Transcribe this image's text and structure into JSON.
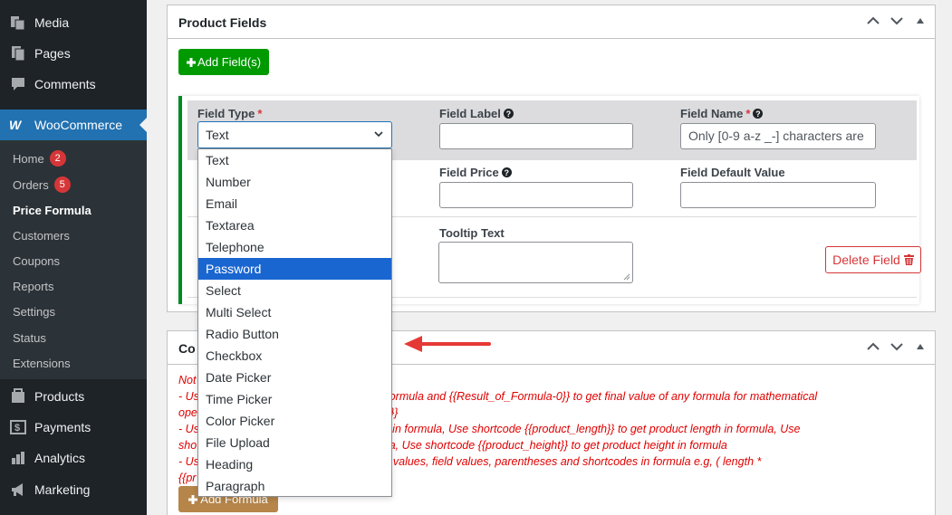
{
  "sidebar": {
    "top_items": [
      {
        "label": "Media",
        "icon": "media-icon"
      },
      {
        "label": "Pages",
        "icon": "pages-icon"
      },
      {
        "label": "Comments",
        "icon": "comments-icon"
      }
    ],
    "woocommerce": {
      "label": "WooCommerce",
      "icon": "woocommerce-icon"
    },
    "submenu": [
      {
        "label": "Home",
        "badge": "2"
      },
      {
        "label": "Orders",
        "badge": "5"
      },
      {
        "label": "Price Formula",
        "current": true
      },
      {
        "label": "Customers"
      },
      {
        "label": "Coupons"
      },
      {
        "label": "Reports"
      },
      {
        "label": "Settings"
      },
      {
        "label": "Status"
      },
      {
        "label": "Extensions"
      }
    ],
    "bottom_items": [
      {
        "label": "Products",
        "icon": "products-icon"
      },
      {
        "label": "Payments",
        "icon": "payments-icon"
      },
      {
        "label": "Analytics",
        "icon": "analytics-icon"
      },
      {
        "label": "Marketing",
        "icon": "marketing-icon"
      }
    ]
  },
  "product_fields": {
    "title": "Product Fields",
    "add_button": "Add Field(s)",
    "field_type_label": "Field Type",
    "field_type_value": "Text",
    "field_label_label": "Field Label",
    "field_name_label": "Field Name",
    "field_name_placeholder": "Only [0-9 a-z _-] characters are",
    "field_price_label": "Field Price",
    "field_default_label": "Field Default Value",
    "tooltip_label": "Tooltip Text",
    "delete_button": "Delete Field",
    "required_mark": "*",
    "help_glyph": "?"
  },
  "dropdown": {
    "options": [
      "Text",
      "Number",
      "Email",
      "Textarea",
      "Telephone",
      "Password",
      "Select",
      "Multi Select",
      "Radio Button",
      "Checkbox",
      "Date Picker",
      "Time Picker",
      "Color Picker",
      "File Upload",
      "Heading",
      "Paragraph"
    ],
    "highlighted": "Password"
  },
  "conditions_panel": {
    "title_visible": "Co",
    "notes": [
      "Not",
      "- Us                                     oduct price in formula and {{Result_of_Formula-0}} to get final value of any formula for mathematical",
      "ope                                      _of_Formula-1}}",
      "- Us                                     product weight in formula, Use shortcode {{product_length}} to get product length in formula, Use",
      "sho                                      width in formula, Use shortcode {{product_height}} to get product height in formula",
      "- Us                                     tical operators, values, field values, parentheses and shortcodes in formula e.g, ( length *",
      "{{pr                                     }} - 30"
    ],
    "add_formula_button": "Add Formula"
  },
  "colors": {
    "sidebar_bg": "#1d2327",
    "accent_blue": "#2271b1",
    "green_button": "#009a00",
    "delete_red": "#d63638",
    "highlight": "#1a66d1",
    "note_red": "#e00000",
    "arrow_red": "#e53935"
  }
}
